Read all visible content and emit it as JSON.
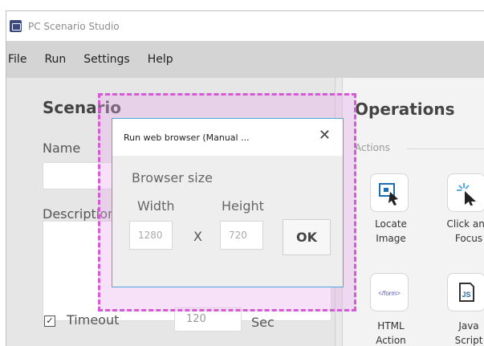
{
  "app": {
    "title": "PC Scenario Studio",
    "icon": "pc-scenario-app-icon"
  },
  "menu": [
    {
      "label": "File"
    },
    {
      "label": "Run"
    },
    {
      "label": "Settings"
    },
    {
      "label": "Help"
    }
  ],
  "scenario": {
    "title": "Scenario",
    "name_label": "Name",
    "description_label": "Description",
    "timeout_label": "Timeout",
    "timeout_checked": true,
    "timeout_value": "120",
    "timeout_unit": "Sec"
  },
  "operations": {
    "title": "Operations",
    "actions_label": "Actions",
    "tools": [
      {
        "label": "Locate\nImage",
        "icon": "locate-image-icon"
      },
      {
        "label": "Click and\nFocus",
        "icon": "click-and-focus-icon"
      },
      {
        "label": "HTML\nAction",
        "icon": "html-action-icon"
      },
      {
        "label": "Java\nScript",
        "icon": "javascript-icon"
      }
    ]
  },
  "dialog": {
    "title": "Run web browser (Manual ...",
    "close": "✕",
    "browser_size_label": "Browser size",
    "width_label": "Width",
    "height_label": "Height",
    "width_value": "1280",
    "height_value": "720",
    "separator": "X",
    "ok_label": "OK"
  },
  "colors": {
    "highlight_border": "#d35bd3",
    "dialog_border": "#4ba7d8",
    "menu_bg": "#d4d4d4"
  }
}
